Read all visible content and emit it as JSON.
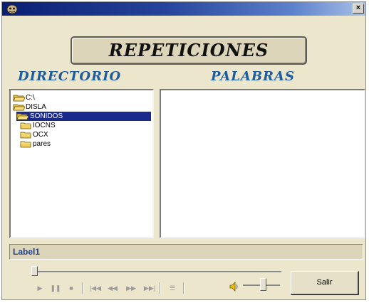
{
  "window": {
    "close_label": "×"
  },
  "heading": {
    "title": "REPETICIONES"
  },
  "labels": {
    "directory": "DIRECTORIO",
    "words": "PALABRAS"
  },
  "tree": {
    "items": [
      {
        "label": "C:\\",
        "level": 0,
        "selected": false
      },
      {
        "label": "DISLA",
        "level": 0,
        "selected": false
      },
      {
        "label": "SONIDOS",
        "level": 1,
        "selected": true
      },
      {
        "label": "IOCNS",
        "level": 2,
        "selected": false
      },
      {
        "label": "OCX",
        "level": 2,
        "selected": false
      },
      {
        "label": "pares",
        "level": 2,
        "selected": false
      }
    ]
  },
  "status": {
    "text": "Label1"
  },
  "player": {
    "controls": [
      {
        "name": "play-button",
        "glyph": "▶"
      },
      {
        "name": "pause-button",
        "glyph": "❚❚"
      },
      {
        "name": "stop-button",
        "glyph": "■"
      },
      {
        "name": "previous-mark-button",
        "glyph": "|◀◀"
      },
      {
        "name": "rewind-button",
        "glyph": "◀◀"
      },
      {
        "name": "fast-forward-button",
        "glyph": "▶▶"
      },
      {
        "name": "next-mark-button",
        "glyph": "▶▶|"
      },
      {
        "name": "playlist-button",
        "glyph": "☰"
      }
    ],
    "seek_position": 0.0,
    "volume_level": 0.55
  },
  "buttons": {
    "exit_label": "Salir"
  },
  "colors": {
    "accent": "#1d5c9e",
    "selection": "#1a2a8c",
    "window_bg": "#ece6cc"
  }
}
